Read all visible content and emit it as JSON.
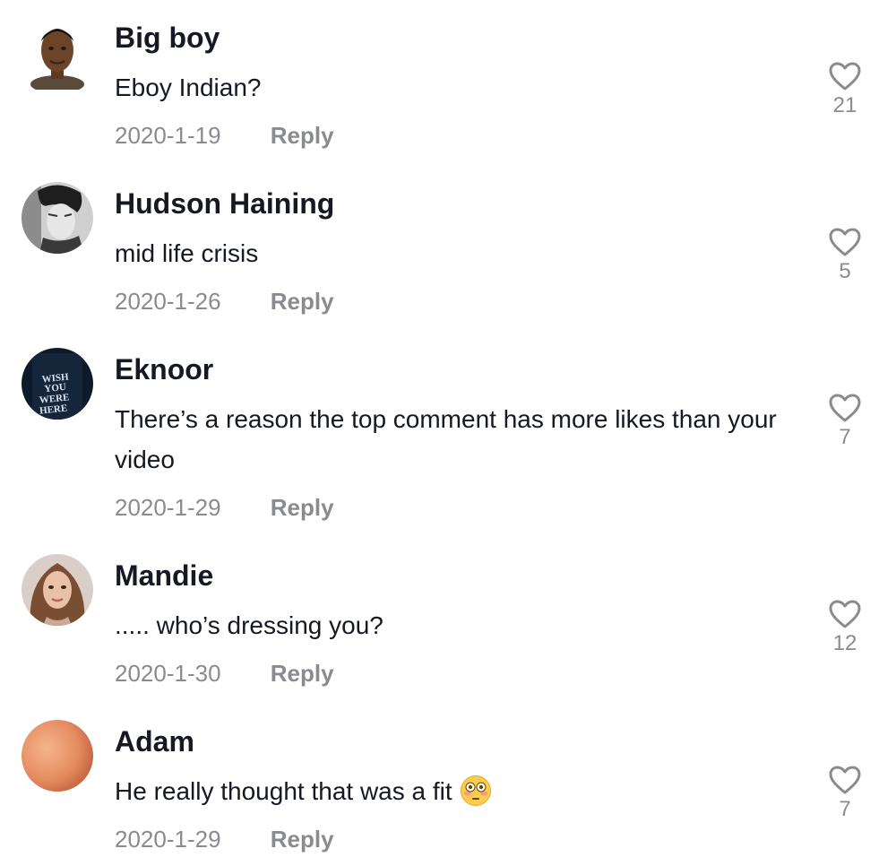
{
  "comments": [
    {
      "username": "Big boy",
      "text": "Eboy Indian?",
      "date": "2020-1-19",
      "reply_label": "Reply",
      "likes": "21",
      "avatar": "man-face-avatar"
    },
    {
      "username": "Hudson Haining",
      "text": "mid life crisis",
      "date": "2020-1-26",
      "reply_label": "Reply",
      "likes": "5",
      "avatar": "bw-portrait-avatar"
    },
    {
      "username": "Eknoor",
      "text": "There’s a reason the top comment has more likes than your video",
      "date": "2020-1-29",
      "reply_label": "Reply",
      "likes": "7",
      "avatar": "wish-you-were-here-avatar",
      "avatar_text": "WISH YOU WERE HERE"
    },
    {
      "username": "Mandie",
      "text": "..... who’s dressing you?",
      "date": "2020-1-30",
      "reply_label": "Reply",
      "likes": "12",
      "avatar": "woman-portrait-avatar"
    },
    {
      "username": "Adam",
      "text": "He really thought that was a fit",
      "emoji": "flushed-face-emoji",
      "date": "2020-1-29",
      "reply_label": "Reply",
      "likes": "7",
      "avatar": "orange-gradient-avatar"
    }
  ],
  "colors": {
    "text_primary": "#161823",
    "text_secondary": "#8a8b91",
    "heart_outline": "#8a8b91",
    "background": "#ffffff"
  },
  "icons": {
    "like": "heart-outline-icon"
  }
}
